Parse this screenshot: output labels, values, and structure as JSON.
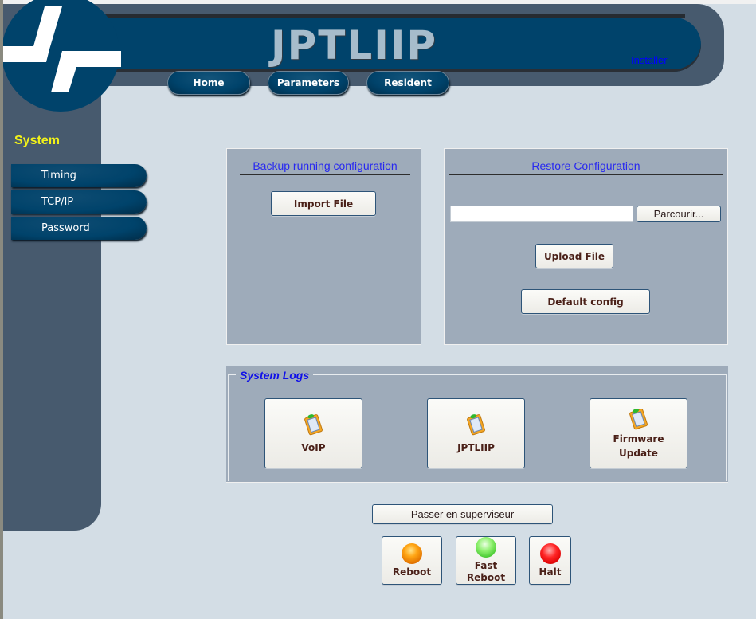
{
  "header": {
    "app_title": "JPTLIIP",
    "user_role_link": "Installer",
    "nav": [
      {
        "label": "Home"
      },
      {
        "label": "Parameters"
      },
      {
        "label": "Resident"
      }
    ]
  },
  "sidebar": {
    "section_title": "System",
    "items": [
      {
        "label": "Timing"
      },
      {
        "label": "TCP/IP"
      },
      {
        "label": "Password"
      }
    ]
  },
  "backup": {
    "title": "Backup running configuration",
    "import_button": "Import File"
  },
  "restore": {
    "title": "Restore Configuration",
    "file_input_value": "",
    "browse_button": "Parcourir...",
    "upload_button": "Upload File",
    "default_button": "Default config"
  },
  "logs": {
    "legend": "System Logs",
    "buttons": [
      {
        "label": "VoIP",
        "icon": "clipboard-icon"
      },
      {
        "label": "JPTLIIP",
        "icon": "clipboard-icon"
      },
      {
        "label_line1": "Firmware",
        "label_line2": "Update",
        "icon": "clipboard-icon"
      }
    ]
  },
  "supervisor_button": "Passer en superviseur",
  "power": {
    "reboot": {
      "label": "Reboot",
      "color": "#ff9a00"
    },
    "fast_reboot": {
      "label_line1": "Fast",
      "label_line2": "Reboot",
      "color": "#5ee040"
    },
    "halt": {
      "label": "Halt",
      "color": "#ee0000"
    }
  },
  "colors": {
    "frame": "#475a6e",
    "banner": "#00436b",
    "background": "#d3dde5",
    "panel": "#9eabba",
    "sidebar_title": "#f2f219",
    "link": "#0000ff"
  }
}
